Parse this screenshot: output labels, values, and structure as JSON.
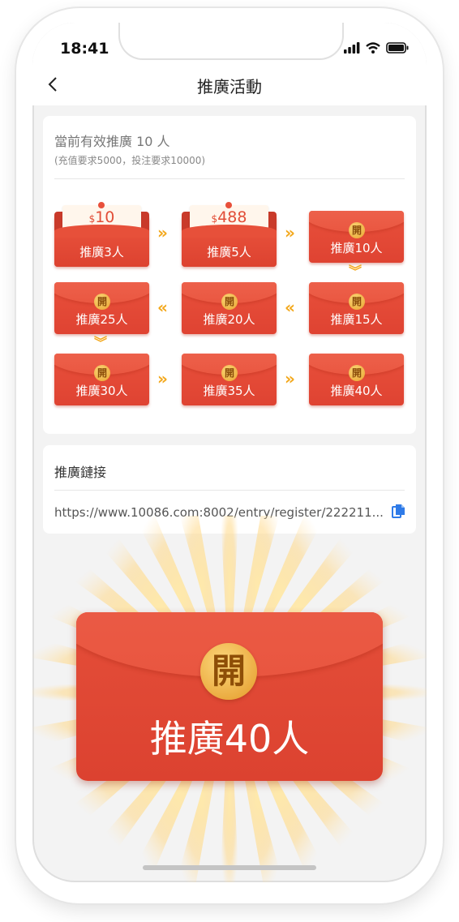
{
  "status": {
    "time": "18:41"
  },
  "nav": {
    "title": "推廣活動"
  },
  "summary": {
    "title": "當前有效推廣 10 人",
    "subtitle": "(充值要求5000，投注要求10000)"
  },
  "envelopes": [
    {
      "label": "推廣3人",
      "state": "opened",
      "amount": "10",
      "currency": "$"
    },
    {
      "label": "推廣5人",
      "state": "opened",
      "amount": "488",
      "currency": "$"
    },
    {
      "label": "推廣10人",
      "state": "sealed",
      "seal": "開"
    },
    {
      "label": "推廣25人",
      "state": "sealed",
      "seal": "開"
    },
    {
      "label": "推廣20人",
      "state": "sealed",
      "seal": "開"
    },
    {
      "label": "推廣15人",
      "state": "sealed",
      "seal": "開"
    },
    {
      "label": "推廣30人",
      "state": "sealed",
      "seal": "開"
    },
    {
      "label": "推廣35人",
      "state": "sealed",
      "seal": "開"
    },
    {
      "label": "推廣40人",
      "state": "sealed",
      "seal": "開"
    }
  ],
  "arrows": {
    "right": "»",
    "left": "«",
    "down": "︾"
  },
  "link": {
    "title": "推廣鏈接",
    "url": "https://www.10086.com:8002/entry/register/222211...",
    "copy_icon": "copy-icon"
  },
  "big_envelope": {
    "seal": "開",
    "label": "推廣40人"
  },
  "colors": {
    "envelope_red": "#e04733",
    "seal_gold": "#f0b440",
    "arrow": "#f3a81c"
  }
}
